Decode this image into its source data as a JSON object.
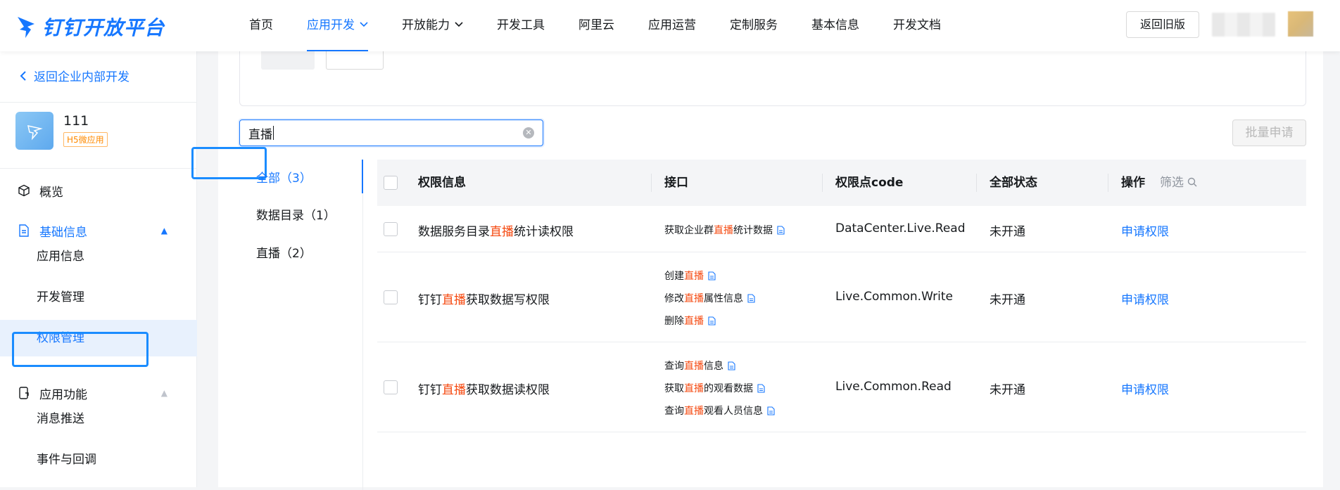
{
  "brand": {
    "name": "钉钉开放平台",
    "accent": "#1677ff",
    "highlight": "#f5480f"
  },
  "nav": {
    "items": [
      {
        "label": "首页",
        "active": false,
        "dropdown": false
      },
      {
        "label": "应用开发",
        "active": true,
        "dropdown": true
      },
      {
        "label": "开放能力",
        "active": false,
        "dropdown": true
      },
      {
        "label": "开发工具",
        "active": false,
        "dropdown": false
      },
      {
        "label": "阿里云",
        "active": false,
        "dropdown": false
      },
      {
        "label": "应用运营",
        "active": false,
        "dropdown": false
      },
      {
        "label": "定制服务",
        "active": false,
        "dropdown": false
      },
      {
        "label": "基本信息",
        "active": false,
        "dropdown": false
      },
      {
        "label": "开发文档",
        "active": false,
        "dropdown": false
      }
    ],
    "old_version_label": "返回旧版"
  },
  "sidebar": {
    "back_label": "返回企业内部开发",
    "app": {
      "name": "111",
      "tag": "H5微应用"
    },
    "overview": "概览",
    "basic_info": "基础信息",
    "app_info": "应用信息",
    "dev_manage": "开发管理",
    "permission_manage": "权限管理",
    "app_features": "应用功能",
    "message_push": "消息推送",
    "events": "事件与回调"
  },
  "search": {
    "value": "直播"
  },
  "batch_apply_label": "批量申请",
  "categories": [
    {
      "label": "全部（3）",
      "active": true
    },
    {
      "label": "数据目录（1）",
      "active": false
    },
    {
      "label": "直播（2）",
      "active": false
    }
  ],
  "table": {
    "headers": {
      "permission": "权限信息",
      "api": "接口",
      "code": "权限点code",
      "status": "全部状态",
      "filter": "筛选",
      "action": "操作"
    },
    "rows": [
      {
        "name_pre": "数据服务目录",
        "name_hl": "直播",
        "name_post": "统计读权限",
        "apis": [
          {
            "pre": "获取企业群",
            "hl": "直播",
            "post": "统计数据"
          }
        ],
        "code": "DataCenter.Live.Read",
        "status": "未开通",
        "action": "申请权限"
      },
      {
        "name_pre": "钉钉",
        "name_hl": "直播",
        "name_post": "获取数据写权限",
        "apis": [
          {
            "pre": "创建",
            "hl": "直播",
            "post": ""
          },
          {
            "pre": "修改",
            "hl": "直播",
            "post": "属性信息"
          },
          {
            "pre": "删除",
            "hl": "直播",
            "post": ""
          }
        ],
        "code": "Live.Common.Write",
        "status": "未开通",
        "action": "申请权限"
      },
      {
        "name_pre": "钉钉",
        "name_hl": "直播",
        "name_post": "获取数据读权限",
        "apis": [
          {
            "pre": "查询",
            "hl": "直播",
            "post": "信息"
          },
          {
            "pre": "获取",
            "hl": "直播",
            "post": "的观看数据"
          },
          {
            "pre": "查询",
            "hl": "直播",
            "post": "观看人员信息"
          }
        ],
        "code": "Live.Common.Read",
        "status": "未开通",
        "action": "申请权限"
      }
    ]
  }
}
